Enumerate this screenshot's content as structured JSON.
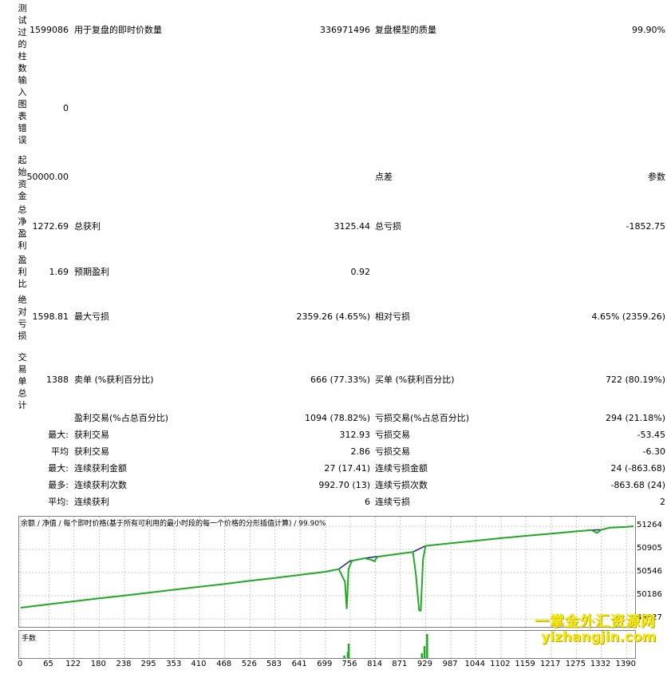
{
  "report": {
    "vertical_labels": [
      "测试过的柱数",
      "输入图表错误",
      "起始资金",
      "总净盈利",
      "盈利比",
      "绝对亏损",
      "交易单总计"
    ],
    "rows": [
      {
        "v": "1599086",
        "l1": "用于复盘的即时价数量",
        "v1": "336971496",
        "l2": "复盘模型的质量",
        "v2": "99.90%"
      },
      {
        "v": "0",
        "l1": "",
        "v1": "",
        "l2": "",
        "v2": ""
      },
      {
        "v": "50000.00",
        "l1": "",
        "v1": "",
        "l2": "点差",
        "v2": "参数"
      },
      {
        "v": "1272.69",
        "l1": "总获利",
        "v1": "3125.44",
        "l2": "总亏损",
        "v2": "-1852.75"
      },
      {
        "v": "1.69",
        "l1": "预期盈利",
        "v1": "0.92",
        "l2": "",
        "v2": ""
      },
      {
        "v": "1598.81",
        "l1": "最大亏损",
        "v1": "2359.26 (4.65%)",
        "l2": "相对亏损",
        "v2": "4.65% (2359.26)"
      },
      {
        "v": "1388",
        "l1": "卖单 (%获利百分比)",
        "v1": "666 (77.33%)",
        "l2": "买单 (%获利百分比)",
        "v2": "722 (80.19%)"
      }
    ],
    "extra_rows": [
      {
        "p": "",
        "l1": "盈利交易(%占总百分比)",
        "v1": "1094 (78.82%)",
        "l2": "亏损交易(%占总百分比)",
        "v2": "294 (21.18%)"
      },
      {
        "p": "最大:",
        "l1": "获利交易",
        "v1": "312.93",
        "l2": "亏损交易",
        "v2": "-53.45"
      },
      {
        "p": "平均",
        "l1": "获利交易",
        "v1": "2.86",
        "l2": "亏损交易",
        "v2": "-6.30"
      },
      {
        "p": "最大:",
        "l1": "连续获利金额",
        "v1": "27 (17.41)",
        "l2": "连续亏损金额",
        "v2": "24 (-863.68)"
      },
      {
        "p": "最多:",
        "l1": "连续获利次数",
        "v1": "992.70 (13)",
        "l2": "连续亏损次数",
        "v2": "-863.68 (24)"
      },
      {
        "p": "平均:",
        "l1": "连续获利",
        "v1": "6",
        "l2": "连续亏损",
        "v2": "2"
      }
    ]
  },
  "chart": {
    "legend": "余额 / 净值 / 每个即时价格(基于所有可利用的最小时段的每一个价格的分形插值计算) / 99.90%",
    "volume_label": "手数",
    "y_ticks": [
      "51264",
      "50905",
      "50546",
      "50186",
      "49827"
    ],
    "x_ticks": [
      "0",
      "65",
      "122",
      "180",
      "238",
      "295",
      "353",
      "410",
      "468",
      "526",
      "583",
      "641",
      "699",
      "756",
      "814",
      "871",
      "929",
      "987",
      "1044",
      "1102",
      "1159",
      "1217",
      "1275",
      "1332",
      "1390"
    ],
    "colors": {
      "balance": "#1a1a8c",
      "equity": "#22aa22",
      "volume": "#22aa22",
      "grid": "#c8c8c8"
    }
  },
  "chart_data": {
    "type": "line",
    "ylim": [
      49827,
      51264
    ],
    "xlim": [
      0,
      1390
    ],
    "y_ticks": [
      51264,
      50905,
      50546,
      50186,
      49827
    ],
    "x_ticks": [
      0,
      65,
      122,
      180,
      238,
      295,
      353,
      410,
      468,
      526,
      583,
      641,
      699,
      756,
      814,
      871,
      929,
      987,
      1044,
      1102,
      1159,
      1217,
      1275,
      1332,
      1390
    ],
    "grid": true,
    "series": [
      {
        "name": "余额",
        "x": [
          0,
          65,
          122,
          180,
          238,
          295,
          353,
          410,
          468,
          526,
          583,
          641,
          699,
          730,
          756,
          790,
          814,
          871,
          900,
          929,
          987,
          1044,
          1102,
          1159,
          1217,
          1275,
          1310,
          1332,
          1350,
          1390,
          1406
        ],
        "y": [
          50000,
          50055,
          50100,
          50145,
          50190,
          50235,
          50280,
          50325,
          50370,
          50418,
          50463,
          50510,
          50558,
          50600,
          50728,
          50768,
          50790,
          50840,
          50865,
          50960,
          51000,
          51040,
          51080,
          51115,
          51150,
          51185,
          51205,
          51210,
          51240,
          51255,
          51264
        ]
      },
      {
        "name": "净值",
        "x": [
          0,
          65,
          122,
          180,
          238,
          295,
          353,
          410,
          468,
          526,
          583,
          641,
          699,
          730,
          744,
          748,
          752,
          760,
          790,
          806,
          812,
          818,
          871,
          900,
          907,
          914,
          918,
          923,
          929,
          987,
          1044,
          1102,
          1159,
          1217,
          1275,
          1310,
          1322,
          1332,
          1350,
          1390,
          1406
        ],
        "y": [
          50000,
          50055,
          50100,
          50145,
          50190,
          50235,
          50280,
          50325,
          50370,
          50418,
          50463,
          50510,
          50558,
          50600,
          50400,
          49980,
          50600,
          50728,
          50768,
          50740,
          50720,
          50790,
          50840,
          50865,
          50500,
          49960,
          49955,
          50750,
          50960,
          51000,
          51040,
          51080,
          51115,
          51150,
          51185,
          51205,
          51160,
          51210,
          51240,
          51255,
          51264
        ]
      }
    ],
    "volume": {
      "name": "手数",
      "x": [
        742,
        750,
        752,
        920,
        926,
        932
      ],
      "values": [
        0.1,
        0.25,
        0.6,
        0.2,
        0.5,
        1.0
      ]
    }
  },
  "watermark": {
    "line1": "一掌金外汇资源网",
    "line2": "yizhangjin.com"
  }
}
